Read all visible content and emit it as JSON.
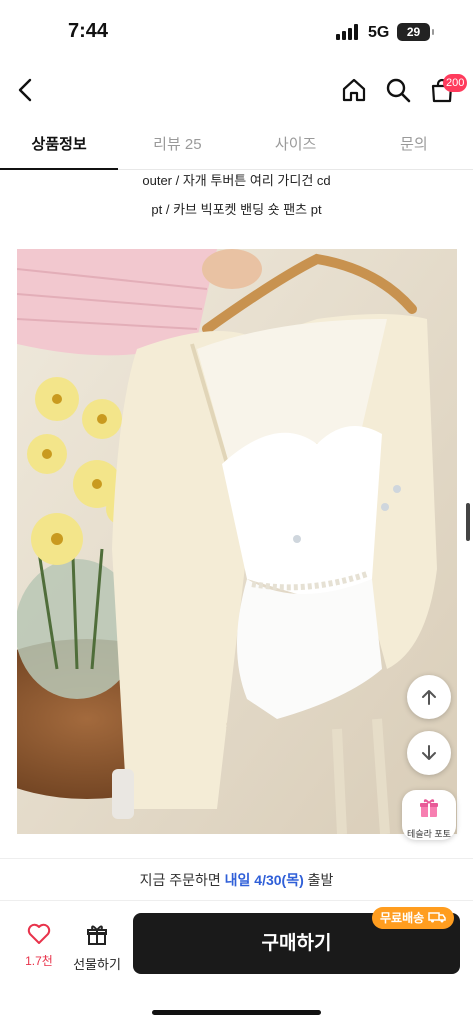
{
  "status_bar": {
    "time": "7:44",
    "network": "5G",
    "battery": "29"
  },
  "header": {
    "cart_badge": "200"
  },
  "tabs": [
    {
      "label": "상품정보",
      "active": true
    },
    {
      "label": "리뷰 25",
      "active": false
    },
    {
      "label": "사이즈",
      "active": false
    },
    {
      "label": "문의",
      "active": false
    }
  ],
  "description": {
    "line1": "outer / 자개 투버튼 여리 가디건 cd",
    "line2": "pt / 카브 빅포켓 밴딩 숏 팬츠 pt"
  },
  "floating": {
    "gift_label": "테슬라 포토"
  },
  "notice": {
    "prefix": "지금 주문하면 ",
    "date": "내일 4/30(목)",
    "suffix": " 출발"
  },
  "bottom": {
    "like_count": "1.7천",
    "gift_label": "선물하기",
    "buy_label": "구매하기",
    "free_ship": "무료배송"
  },
  "colors": {
    "accent_blue": "#2f5fd8",
    "heart_red": "#e8334b",
    "ship_orange": "#ff9d1f",
    "badge_red": "#ff3b5c"
  },
  "icons": [
    "back-icon",
    "home-icon",
    "search-icon",
    "cart-icon",
    "arrow-up-icon",
    "arrow-down-icon",
    "gift-icon",
    "heart-icon",
    "truck-icon"
  ]
}
